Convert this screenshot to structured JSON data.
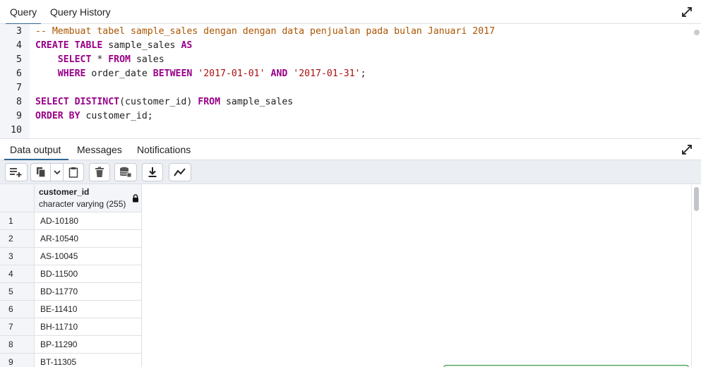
{
  "top_tabs": [
    {
      "label": "Query"
    },
    {
      "label": "Query History"
    }
  ],
  "editor": {
    "lines": [
      {
        "num": "3",
        "tokens": [
          {
            "t": "-- Membuat tabel sample_sales dengan dengan data penjualan pada bulan Januari 2017",
            "c": "cm"
          }
        ]
      },
      {
        "num": "4",
        "tokens": [
          {
            "t": "CREATE TABLE",
            "c": "kw"
          },
          {
            "t": " sample_sales ",
            "c": ""
          },
          {
            "t": "AS",
            "c": "kw"
          }
        ]
      },
      {
        "num": "5",
        "tokens": [
          {
            "t": "    ",
            "c": ""
          },
          {
            "t": "SELECT",
            "c": "kw"
          },
          {
            "t": " * ",
            "c": ""
          },
          {
            "t": "FROM",
            "c": "kw"
          },
          {
            "t": " sales",
            "c": ""
          }
        ]
      },
      {
        "num": "6",
        "tokens": [
          {
            "t": "    ",
            "c": ""
          },
          {
            "t": "WHERE",
            "c": "kw"
          },
          {
            "t": " order_date ",
            "c": ""
          },
          {
            "t": "BETWEEN",
            "c": "kw"
          },
          {
            "t": " ",
            "c": ""
          },
          {
            "t": "'2017-01-01'",
            "c": "st"
          },
          {
            "t": " ",
            "c": ""
          },
          {
            "t": "AND",
            "c": "kw"
          },
          {
            "t": " ",
            "c": ""
          },
          {
            "t": "'2017-01-31'",
            "c": "st"
          },
          {
            "t": ";",
            "c": ""
          }
        ]
      },
      {
        "num": "7",
        "tokens": []
      },
      {
        "num": "8",
        "tokens": [
          {
            "t": "SELECT DISTINCT",
            "c": "kw"
          },
          {
            "t": "(customer_id) ",
            "c": ""
          },
          {
            "t": "FROM",
            "c": "kw"
          },
          {
            "t": " sample_sales",
            "c": ""
          }
        ]
      },
      {
        "num": "9",
        "tokens": [
          {
            "t": "ORDER BY",
            "c": "kw"
          },
          {
            "t": " customer_id;",
            "c": ""
          }
        ]
      },
      {
        "num": "10",
        "tokens": []
      }
    ]
  },
  "bottom_tabs": [
    {
      "label": "Data output"
    },
    {
      "label": "Messages"
    },
    {
      "label": "Notifications"
    }
  ],
  "toolbar": {
    "icons": [
      "add-row-icon",
      "copy-icon",
      "chevron-down-icon",
      "paste-icon",
      "delete-icon",
      "save-data-icon",
      "download-icon",
      "graph-icon"
    ]
  },
  "grid": {
    "column": {
      "name": "customer_id",
      "type": "character varying (255)"
    },
    "rows": [
      {
        "n": "1",
        "v": "AD-10180"
      },
      {
        "n": "2",
        "v": "AR-10540"
      },
      {
        "n": "3",
        "v": "AS-10045"
      },
      {
        "n": "4",
        "v": "BD-11500"
      },
      {
        "n": "5",
        "v": "BD-11770"
      },
      {
        "n": "6",
        "v": "BE-11410"
      },
      {
        "n": "7",
        "v": "BH-11710"
      },
      {
        "n": "8",
        "v": "BP-11290"
      },
      {
        "n": "9",
        "v": "BT-11305"
      }
    ]
  },
  "colors": {
    "accent": "#326690",
    "keyword": "#990088",
    "comment": "#aa5500",
    "string": "#aa1111"
  }
}
